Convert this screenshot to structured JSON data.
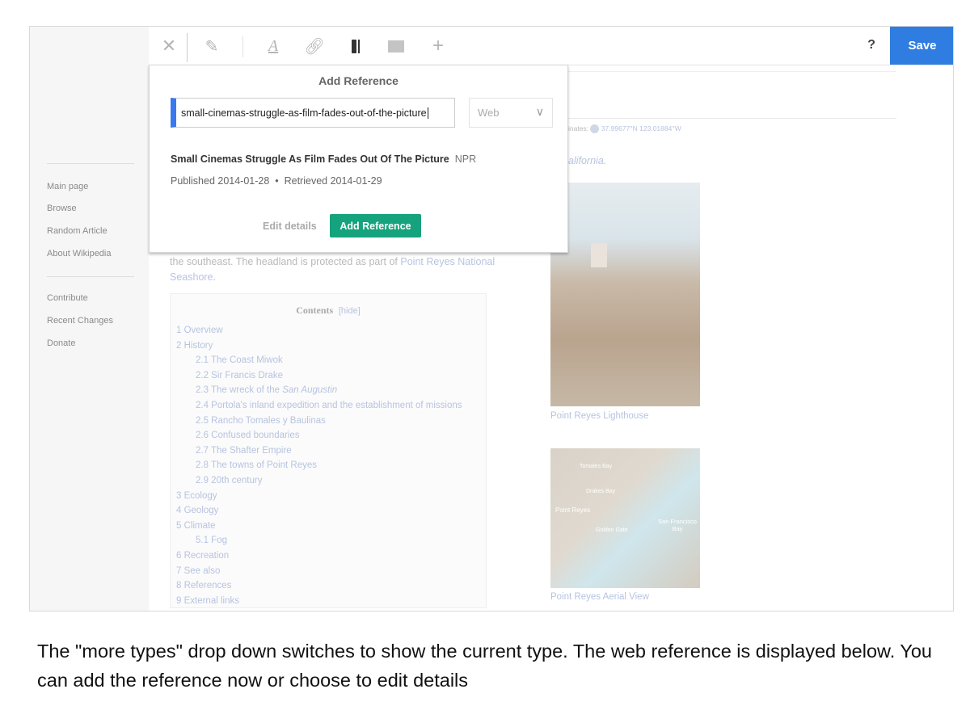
{
  "sidebar": {
    "items": [
      "Main page",
      "Browse",
      "Random Article",
      "About Wikipedia"
    ],
    "items2": [
      "Contribute",
      "Recent Changes",
      "Donate"
    ]
  },
  "toolbar": {
    "icons": [
      "close-icon",
      "edit-preview-icon",
      "text-style-icon",
      "link-icon",
      "cite-icon",
      "insert-media-icon",
      "insert-more-icon"
    ],
    "help": "?",
    "save": "Save",
    "save_color": "#2f7de1"
  },
  "dialog": {
    "title": "Add Reference",
    "url_value": "small-cinemas-struggle-as-film-fades-out-of-the-picture",
    "type_selected": "Web",
    "ref_title": "Small Cinemas Struggle As Film Fades Out Of The Picture",
    "ref_source": "NPR",
    "published": "Published 2014-01-28",
    "retrieved": "Retrieved 2014-01-29",
    "edit_details": "Edit details",
    "add_reference": "Add Reference",
    "add_color": "#14a37c"
  },
  "article": {
    "coords_label": "inates:",
    "coords": "37.99677°N 123.01884°W",
    "california": "alifornia.",
    "para1": "the southeast. The headland is protected as part of ",
    "para1_link": "Point Reyes National",
    "para2_link": "Seashore",
    "para2_end": ".",
    "toc_title": "Contents",
    "toc_hide": "[hide]",
    "toc": [
      "1 Overview",
      "2 History",
      "2.1 The Coast Miwok",
      "2.2 Sir Francis Drake",
      "2.3 The wreck of the San Augustin",
      "2.4 Portola's inland expedition and the establishment of missions",
      "2.5 Rancho Tomales y Baulinas",
      "2.6 Confused boundaries",
      "2.7 The Shafter Empire",
      "2.8 The towns of Point Reyes",
      "2.9 20th century",
      "3 Ecology",
      "4 Geology",
      "5 Climate",
      "5.1 Fog",
      "6 Recreation",
      "7 See also",
      "8 References",
      "9 External links"
    ],
    "photo_caption": "Point Reyes Lighthouse",
    "map_caption": "Point Reyes Aerial View",
    "map_labels": [
      "Tomales Bay",
      "Drakes Bay",
      "Point Reyes",
      "Golden Gate",
      "San Francisco Bay"
    ]
  },
  "caption": "The \"more types\" drop down switches to show the current type. The web reference is displayed below. You can add the reference now or choose to edit details"
}
